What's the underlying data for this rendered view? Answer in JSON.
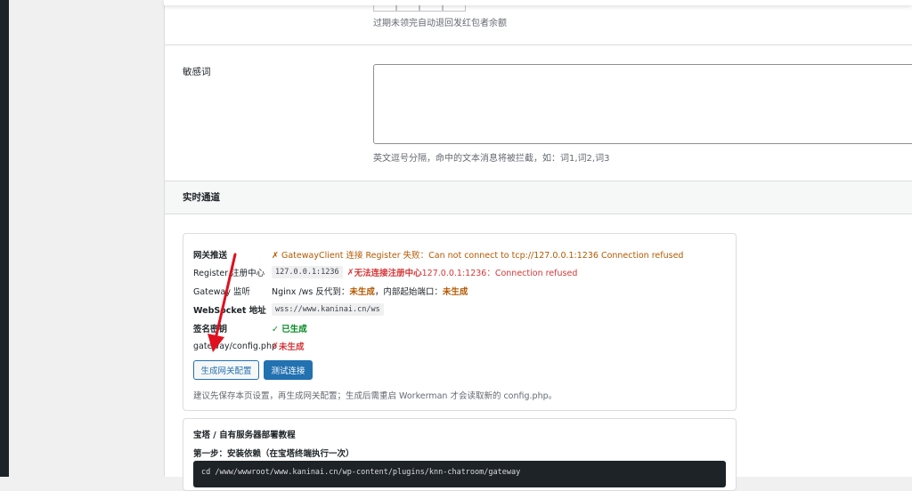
{
  "top_hint": "过期未领完自动退回发红包者余额",
  "sensitive": {
    "label": "敏感词",
    "value": "",
    "hint": "英文逗号分隔，命中的文本消息将被拦截，如：词1,词2,词3"
  },
  "realtime": {
    "title": "实时通道",
    "status": {
      "gateway_push": {
        "label": "网关推送",
        "value": "✗ GatewayClient 连接 Register 失败：Can not connect to tcp://127.0.0.1:1236 Connection refused"
      },
      "register": {
        "label": "Register 注册中心",
        "address": "127.0.0.1:1236",
        "prefix": "✗ ",
        "status_text": "无法连接注册中心",
        "detail": " 127.0.0.1:1236：Connection refused"
      },
      "gateway_listen": {
        "label": "Gateway 监听",
        "prefix": "Nginx /ws 反代到：",
        "status1": "未生成",
        "middle": "，内部起始端口：",
        "status2": "未生成"
      },
      "websocket": {
        "label": "WebSocket 地址",
        "value": "wss://www.kaninai.cn/ws"
      },
      "signing_key": {
        "label": "签名密钥",
        "value": "✓ 已生成"
      },
      "config_file": {
        "label": "gateway/config.php",
        "prefix": "✗ ",
        "status_text": "未生成"
      }
    },
    "buttons": {
      "generate": "生成网关配置",
      "test": "测试连接"
    },
    "note": "建议先保存本页设置，再生成网关配置；生成后需重启 Workerman 才会读取新的 config.php。"
  },
  "tutorial": {
    "title": "宝塔 / 自有服务器部署教程",
    "step1": "第一步：安装依赖（在宝塔终端执行一次）",
    "code": "cd /www/wwwroot/www.kaninai.cn/wp-content/plugins/knn-chatroom/gateway"
  },
  "colors": {
    "accent": "#2271b1",
    "warning": "#b35900",
    "error": "#d63638",
    "success": "#008a20",
    "annotation_arrow": "#e0101f"
  },
  "icons": [
    "cross-icon",
    "check-icon",
    "annotation-arrow-icon"
  ]
}
